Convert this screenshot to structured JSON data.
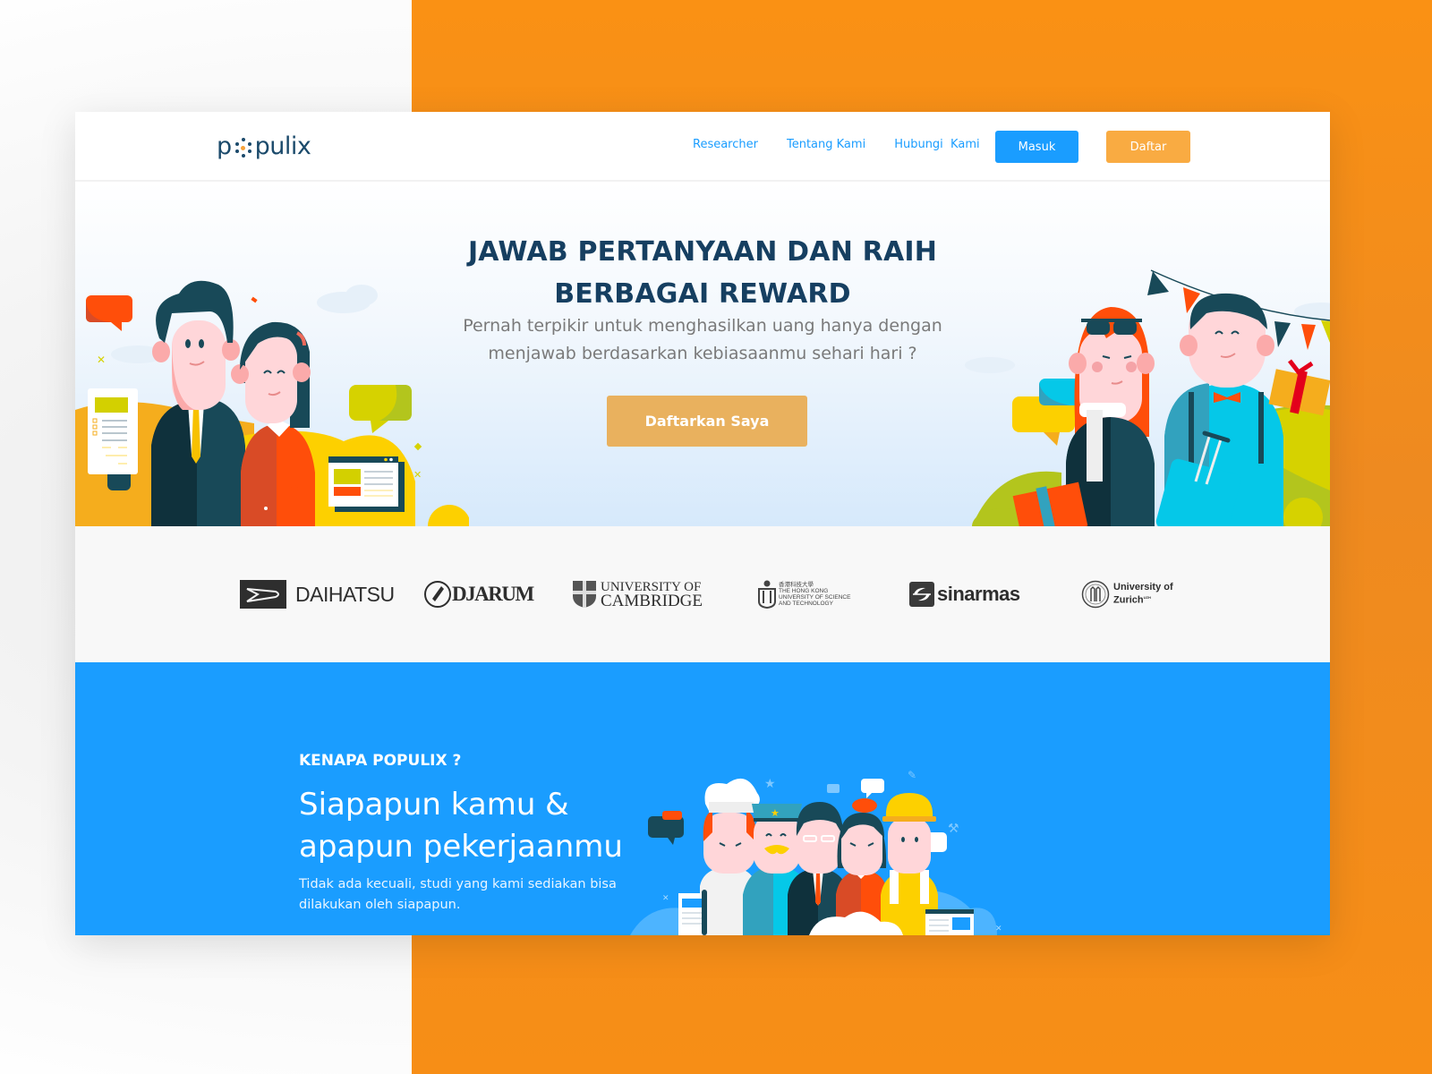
{
  "colors": {
    "brand_blue": "#1A9DFF",
    "brand_navy": "#163F61",
    "accent_orange": "#F9AB42",
    "cta_orange": "#E9B15E",
    "backdrop_orange": "#F7901E"
  },
  "nav": {
    "logo_text_before": "p",
    "logo_text_after": "pulix",
    "links": [
      {
        "label": "Researcher"
      },
      {
        "label": "Tentang Kami"
      },
      {
        "label": "Hubungi  Kami"
      }
    ],
    "login_label": "Masuk",
    "register_label": "Daftar"
  },
  "hero": {
    "title_line1": "JAWAB PERTANYAAN DAN RAIH",
    "title_line2": "BERBAGAI REWARD",
    "subtitle_line1": "Pernah terpikir untuk menghasilkan uang hanya dengan",
    "subtitle_line2": "menjawab berdasarkan kebiasaanmu sehari hari ?",
    "cta_label": "Daftarkan Saya"
  },
  "partners": [
    {
      "name": "DAIHATSU"
    },
    {
      "name": "DJARUM"
    },
    {
      "name_line1": "UNIVERSITY OF",
      "name_line2": "CAMBRIDGE"
    },
    {
      "name_line1": "香港科技大學",
      "name_line2": "THE HONG KONG",
      "name_line3": "UNIVERSITY OF SCIENCE",
      "name_line4": "AND TECHNOLOGY"
    },
    {
      "name": "sinarmas"
    },
    {
      "name_line1": "University of",
      "name_line2": "Zurich",
      "suffix": "UZH"
    }
  ],
  "why": {
    "kicker": "KENAPA POPULIX ?",
    "title_line1": "Siapapun kamu &",
    "title_line2": "apapun pekerjaanmu",
    "text_line1": "Tidak ada kecuali, studi yang kami sediakan bisa",
    "text_line2": "dilakukan oleh siapapun."
  }
}
